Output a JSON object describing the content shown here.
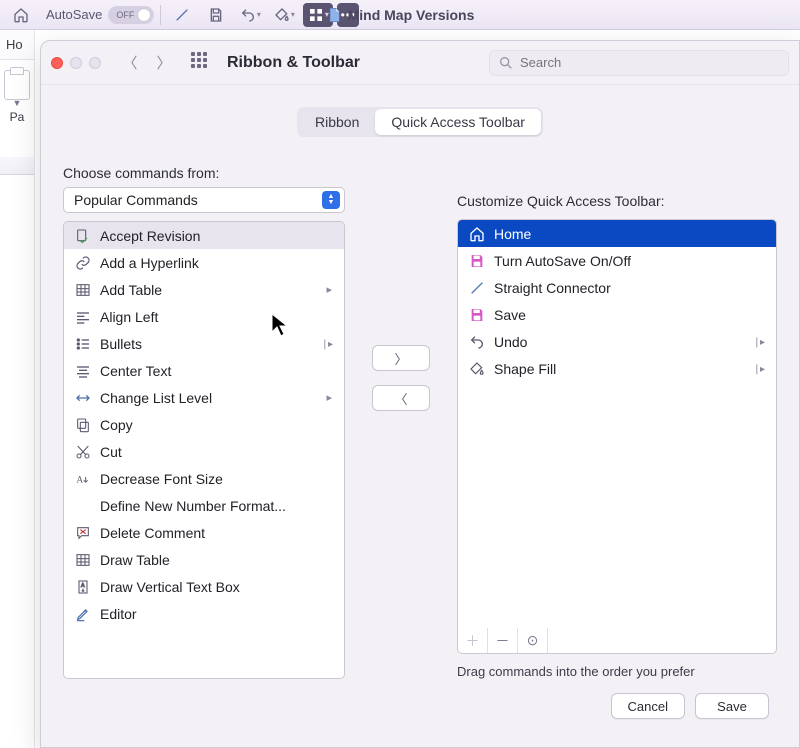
{
  "chrome": {
    "autosave_label": "AutoSave",
    "autosave_state": "OFF",
    "doc_title": "Mind Map Versions"
  },
  "underlay": {
    "home_tab_fragment": "Ho",
    "paste_fragment": "Pa"
  },
  "pref": {
    "title": "Ribbon & Toolbar",
    "search_placeholder": "Search",
    "tabs": {
      "ribbon": "Ribbon",
      "qat": "Quick Access Toolbar"
    },
    "left_label": "Choose commands from:",
    "dropdown_value": "Popular Commands",
    "right_label": "Customize Quick Access Toolbar:",
    "hint": "Drag commands into the order you prefer",
    "cancel": "Cancel",
    "save": "Save"
  },
  "left_commands": [
    {
      "icon": "accept",
      "label": "Accept Revision",
      "selected": true
    },
    {
      "icon": "link",
      "label": "Add a Hyperlink"
    },
    {
      "icon": "table",
      "label": "Add Table",
      "sub": "tri"
    },
    {
      "icon": "alignl",
      "label": "Align Left"
    },
    {
      "icon": "bullets",
      "label": "Bullets",
      "sub": "bar"
    },
    {
      "icon": "center",
      "label": "Center Text"
    },
    {
      "icon": "listlvl",
      "label": "Change List Level",
      "sub": "tri"
    },
    {
      "icon": "copy",
      "label": "Copy"
    },
    {
      "icon": "cut",
      "label": "Cut"
    },
    {
      "icon": "fontdn",
      "label": "Decrease Font Size"
    },
    {
      "icon": "",
      "label": "Define New Number Format..."
    },
    {
      "icon": "delcom",
      "label": "Delete Comment"
    },
    {
      "icon": "drawtbl",
      "label": "Draw Table"
    },
    {
      "icon": "vtext",
      "label": "Draw Vertical Text Box"
    },
    {
      "icon": "editor",
      "label": "Editor"
    }
  ],
  "right_commands": [
    {
      "icon": "home",
      "label": "Home",
      "highlight": true
    },
    {
      "icon": "savepink",
      "label": "Turn AutoSave On/Off"
    },
    {
      "icon": "line",
      "label": "Straight Connector"
    },
    {
      "icon": "savepink",
      "label": "Save"
    },
    {
      "icon": "undo",
      "label": "Undo",
      "sub": "bar"
    },
    {
      "icon": "fill",
      "label": "Shape Fill",
      "sub": "bar"
    }
  ],
  "icons": {
    "accept": "✎",
    "link": "🔗",
    "table": "▦",
    "alignl": "≡",
    "bullets": "⋮",
    "center": "≡",
    "listlvl": "↔",
    "copy": "⧉",
    "cut": "✂",
    "fontdn": "A↓",
    "delcom": "✕",
    "drawtbl": "▦",
    "vtext": "⇅",
    "editor": "✎",
    "home": "⌂",
    "savepink": "💾",
    "line": "／",
    "undo": "↶",
    "fill": "◇"
  }
}
